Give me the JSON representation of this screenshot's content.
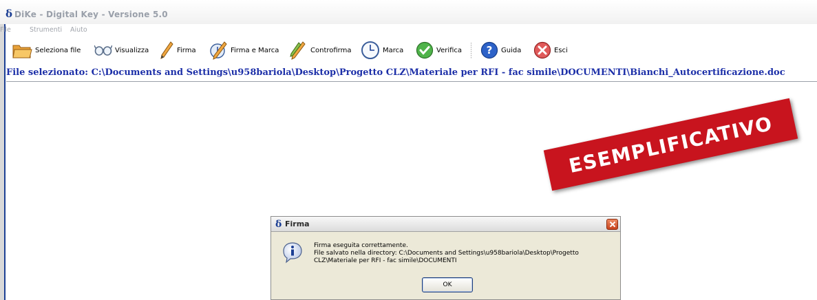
{
  "window": {
    "logo": "δ",
    "title": "DiKe - Digital Key - Versione 5.0"
  },
  "menu": {
    "items": [
      "File",
      "Strumenti",
      "Aiuto"
    ]
  },
  "toolbar": {
    "buttons": [
      {
        "label": "Seleziona file",
        "icon": "folder-icon"
      },
      {
        "label": "Visualizza",
        "icon": "glasses-icon"
      },
      {
        "label": "Firma",
        "icon": "pen-icon"
      },
      {
        "label": "Firma e Marca",
        "icon": "pen-clock-icon"
      },
      {
        "label": "Controfirma",
        "icon": "double-pen-icon"
      },
      {
        "label": "Marca",
        "icon": "clock-icon"
      },
      {
        "label": "Verifica",
        "icon": "check-icon"
      },
      {
        "label": "Guida",
        "icon": "help-icon"
      },
      {
        "label": "Esci",
        "icon": "exit-icon"
      }
    ]
  },
  "file_selected": "File selezionato: C:\\Documents and Settings\\u958bariola\\Desktop\\Progetto CLZ\\Materiale per RFI - fac simile\\DOCUMENTI\\Bianchi_Autocertificazione.doc",
  "stamp": {
    "text": "ESEMPLIFICATIVO",
    "color": "#c8141e"
  },
  "dialog": {
    "logo": "δ",
    "title": "Firma",
    "line1": "Firma eseguita correttamente.",
    "line2": "File salvato nella directory: C:\\Documents and Settings\\u958bariola\\Desktop\\Progetto",
    "line3": "CLZ\\Materiale per RFI - fac simile\\DOCUMENTI",
    "ok_label": "OK",
    "icon": "info-icon"
  },
  "colors": {
    "accent_blue": "#1c3f94",
    "path_text": "#1c2fa8"
  }
}
